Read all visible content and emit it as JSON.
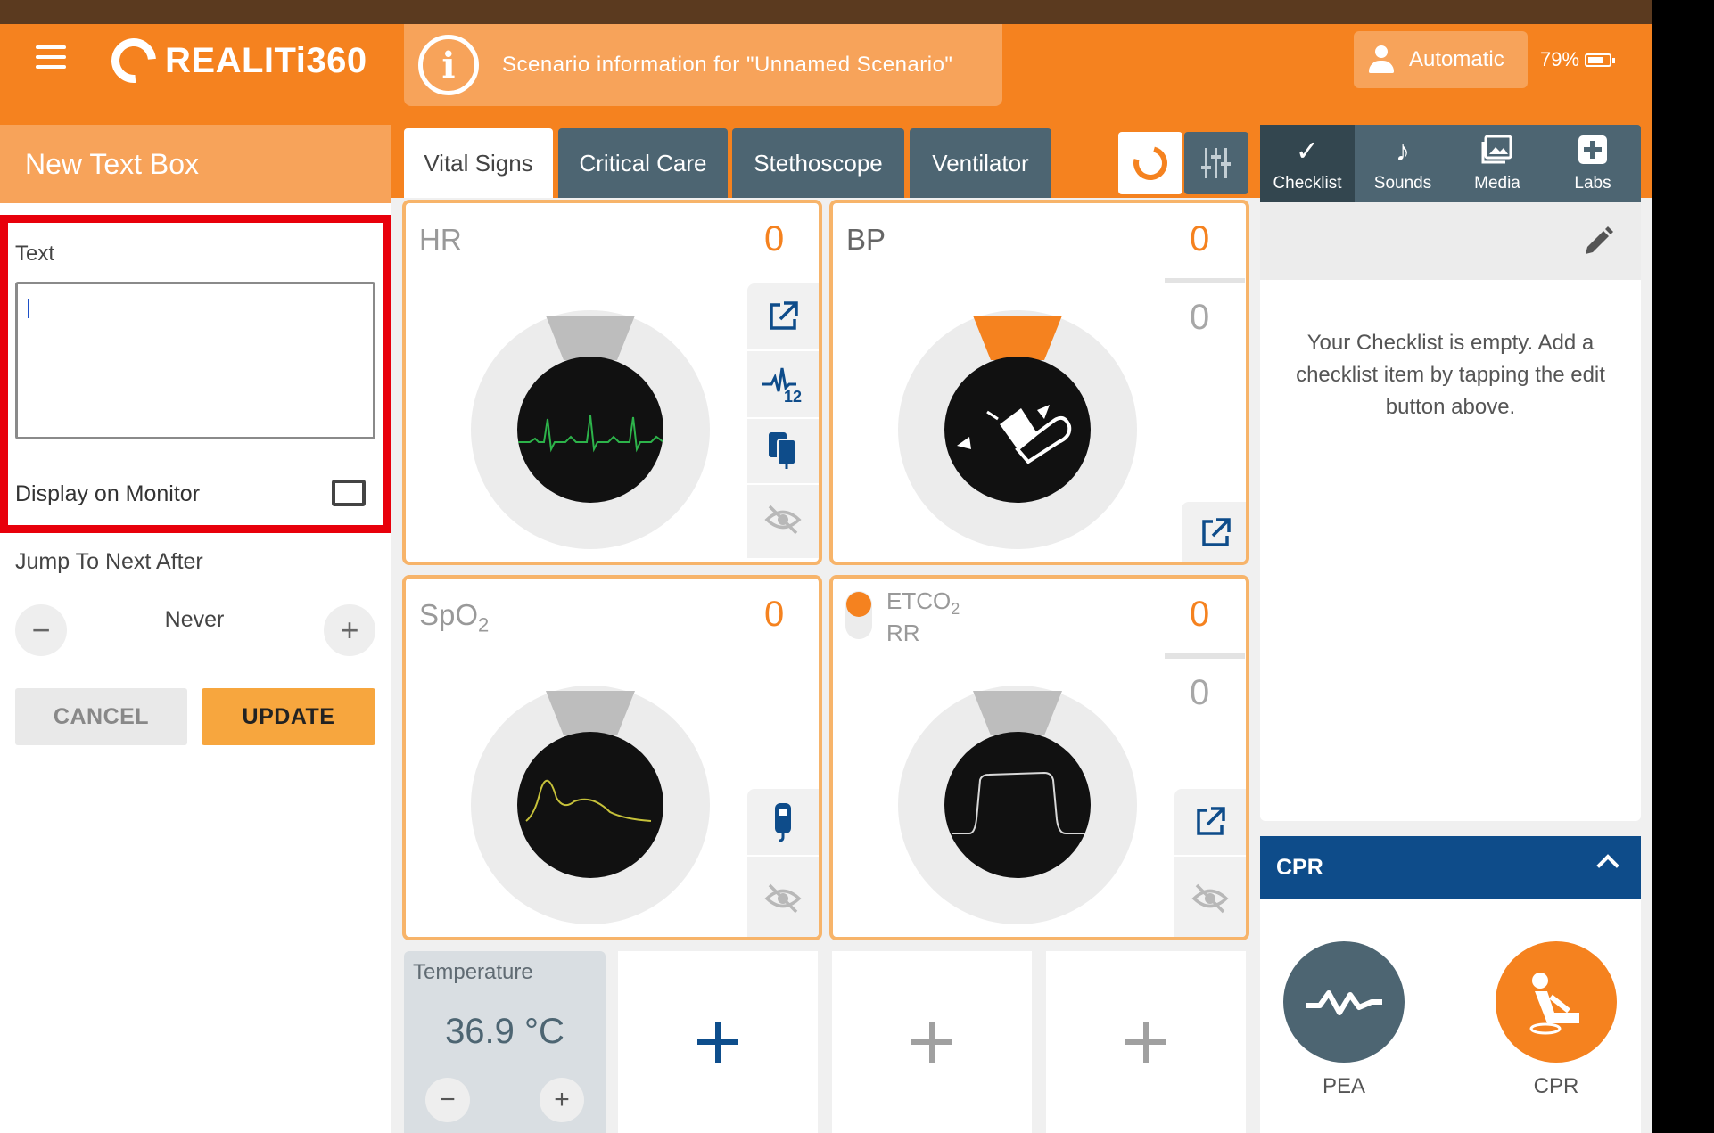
{
  "header": {
    "app_name": "REALITi360",
    "scenario_info": "Scenario information for  \"Unnamed Scenario\"",
    "mode_label": "Automatic",
    "battery": "79%",
    "battery_level": 0.79
  },
  "left_panel": {
    "title": "New Text Box",
    "text_label": "Text",
    "text_value": "",
    "display_on_monitor_label": "Display on Monitor",
    "display_on_monitor_checked": false,
    "jump_label": "Jump To Next After",
    "jump_value": "Never",
    "decrement": "−",
    "increment": "+",
    "cancel": "CANCEL",
    "update": "UPDATE"
  },
  "tabs": [
    {
      "label": "Vital Signs",
      "active": true
    },
    {
      "label": "Critical Care",
      "active": false
    },
    {
      "label": "Stethoscope",
      "active": false
    },
    {
      "label": "Ventilator",
      "active": false
    }
  ],
  "right_tabs": [
    {
      "label": "Checklist",
      "icon": "check-icon",
      "active": true
    },
    {
      "label": "Sounds",
      "icon": "music-note-icon",
      "active": false
    },
    {
      "label": "Media",
      "icon": "image-icon",
      "active": false
    },
    {
      "label": "Labs",
      "icon": "plus-box-icon",
      "active": false
    }
  ],
  "vitals": {
    "hr": {
      "title": "HR",
      "value": "0"
    },
    "bp": {
      "title": "BP",
      "value": "0",
      "value2": "0"
    },
    "spo2": {
      "title": "SpO",
      "sub": "2",
      "value": "0"
    },
    "etco2": {
      "title": "ETCO",
      "sub": "2",
      "title2": "RR",
      "value": "0",
      "value2": "0"
    }
  },
  "temperature": {
    "label": "Temperature",
    "value": "36.9 °C",
    "decrement": "−",
    "increment": "+"
  },
  "checklist": {
    "empty_message": "Your Checklist is empty. Add a checklist item by tapping the edit button above."
  },
  "cpr": {
    "title": "CPR",
    "items": [
      {
        "label": "PEA"
      },
      {
        "label": "CPR"
      }
    ]
  },
  "colors": {
    "brand_orange": "#f5821f",
    "tab_slate": "#4d6572",
    "cpr_blue": "#0e4c8a",
    "highlight_red": "#e8000b"
  }
}
